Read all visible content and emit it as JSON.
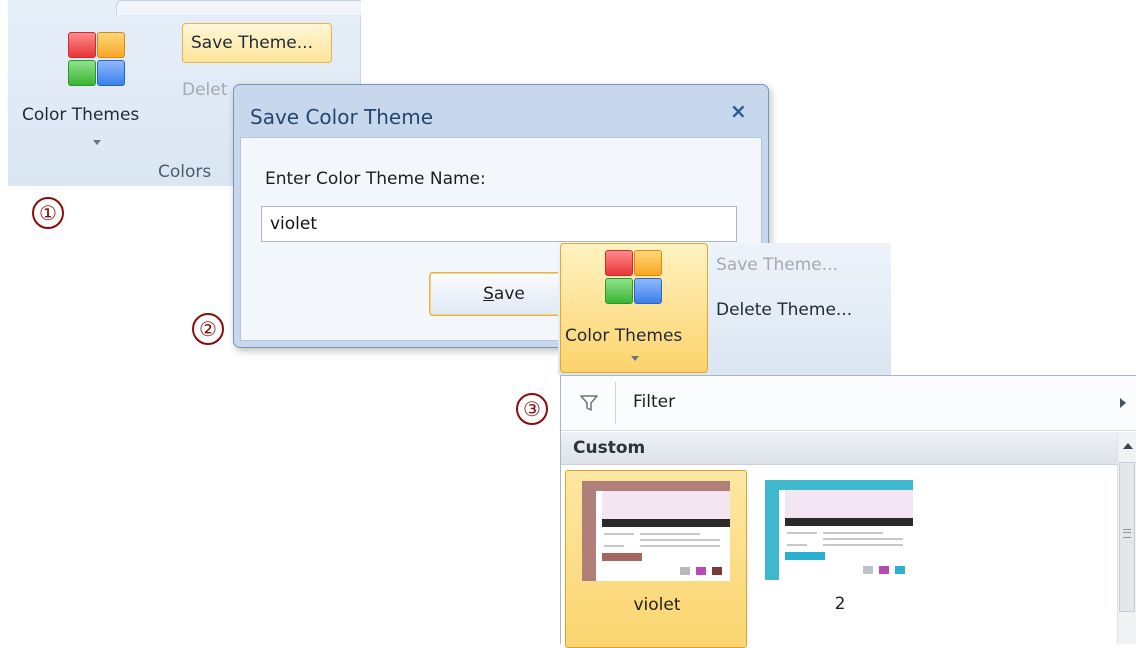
{
  "ribbon_top": {
    "color_themes_label": "Color Themes",
    "save_theme_label": "Save Theme...",
    "delete_theme_label": "Delet",
    "group_label": "Colors"
  },
  "steps": {
    "one": "①",
    "two": "②",
    "three": "③"
  },
  "dialog": {
    "title": "Save Color Theme",
    "close_glyph": "×",
    "prompt": "Enter Color Theme Name:",
    "name_value": "violet",
    "save_label_accel": "S",
    "save_label_rest": "ave"
  },
  "ribbon_bottom": {
    "color_themes_label": "Color Themes",
    "save_theme_label": "Save Theme...",
    "delete_theme_label": "Delete Theme..."
  },
  "gallery": {
    "filter_label": "Filter",
    "section_label": "Custom",
    "themes": [
      {
        "name": "violet",
        "selected": true,
        "accent": "#b17f7a",
        "swatches": [
          "#b9b9b9",
          "#b64ab8",
          "#7b3a3a"
        ]
      },
      {
        "name": "2",
        "selected": false,
        "accent": "#3fb7cc",
        "swatches": [
          "#b9c4c9",
          "#b64ab8",
          "#2ab1d1"
        ]
      }
    ]
  }
}
